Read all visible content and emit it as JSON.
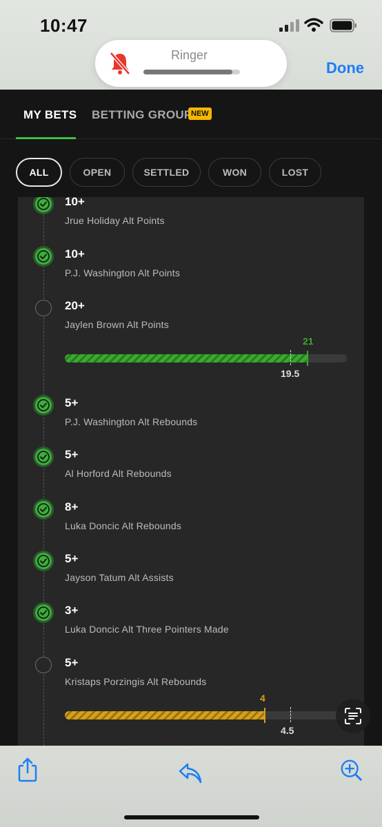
{
  "status_bar": {
    "time": "10:47"
  },
  "ringer": {
    "label": "Ringer",
    "level": 0.92
  },
  "header": {
    "done_label": "Done"
  },
  "tabs": [
    {
      "label": "MY BETS",
      "active": true
    },
    {
      "label": "BETTING GROUPS",
      "badge": "NEW"
    }
  ],
  "filters": [
    {
      "label": "ALL",
      "active": true
    },
    {
      "label": "OPEN"
    },
    {
      "label": "SETTLED"
    },
    {
      "label": "WON"
    },
    {
      "label": "LOST"
    }
  ],
  "legs": [
    {
      "line": "10+",
      "desc": "Jrue Holiday Alt Points",
      "status": "won"
    },
    {
      "line": "10+",
      "desc": "P.J. Washington Alt Points",
      "status": "won"
    },
    {
      "line": "20+",
      "desc": "Jaylen Brown Alt Points",
      "status": "open",
      "progress": {
        "current": "21",
        "current_ratio": 0.86,
        "threshold": "19.5",
        "threshold_ratio": 0.8,
        "color": "#3aaa2e"
      }
    },
    {
      "line": "5+",
      "desc": "P.J. Washington Alt Rebounds",
      "status": "won"
    },
    {
      "line": "5+",
      "desc": "Al Horford Alt Rebounds",
      "status": "won"
    },
    {
      "line": "8+",
      "desc": "Luka Doncic Alt Rebounds",
      "status": "won"
    },
    {
      "line": "5+",
      "desc": "Jayson Tatum Alt Assists",
      "status": "won"
    },
    {
      "line": "3+",
      "desc": "Luka Doncic Alt Three Pointers Made",
      "status": "won"
    },
    {
      "line": "5+",
      "desc": "Kristaps Porzingis Alt Rebounds",
      "status": "open",
      "progress": {
        "current": "4",
        "current_ratio": 0.71,
        "threshold": "4.5",
        "threshold_ratio": 0.8,
        "color": "#d6a21a"
      }
    }
  ],
  "colors": {
    "accent_green": "#3fbf3f",
    "badge_yellow": "#f6b800",
    "ios_blue": "#1a7ef5"
  },
  "icons": {
    "bell": "bell-slash-icon",
    "share": "share-icon",
    "reply": "reply-icon",
    "zoom": "magnify-plus-icon",
    "scan": "live-text-icon"
  }
}
